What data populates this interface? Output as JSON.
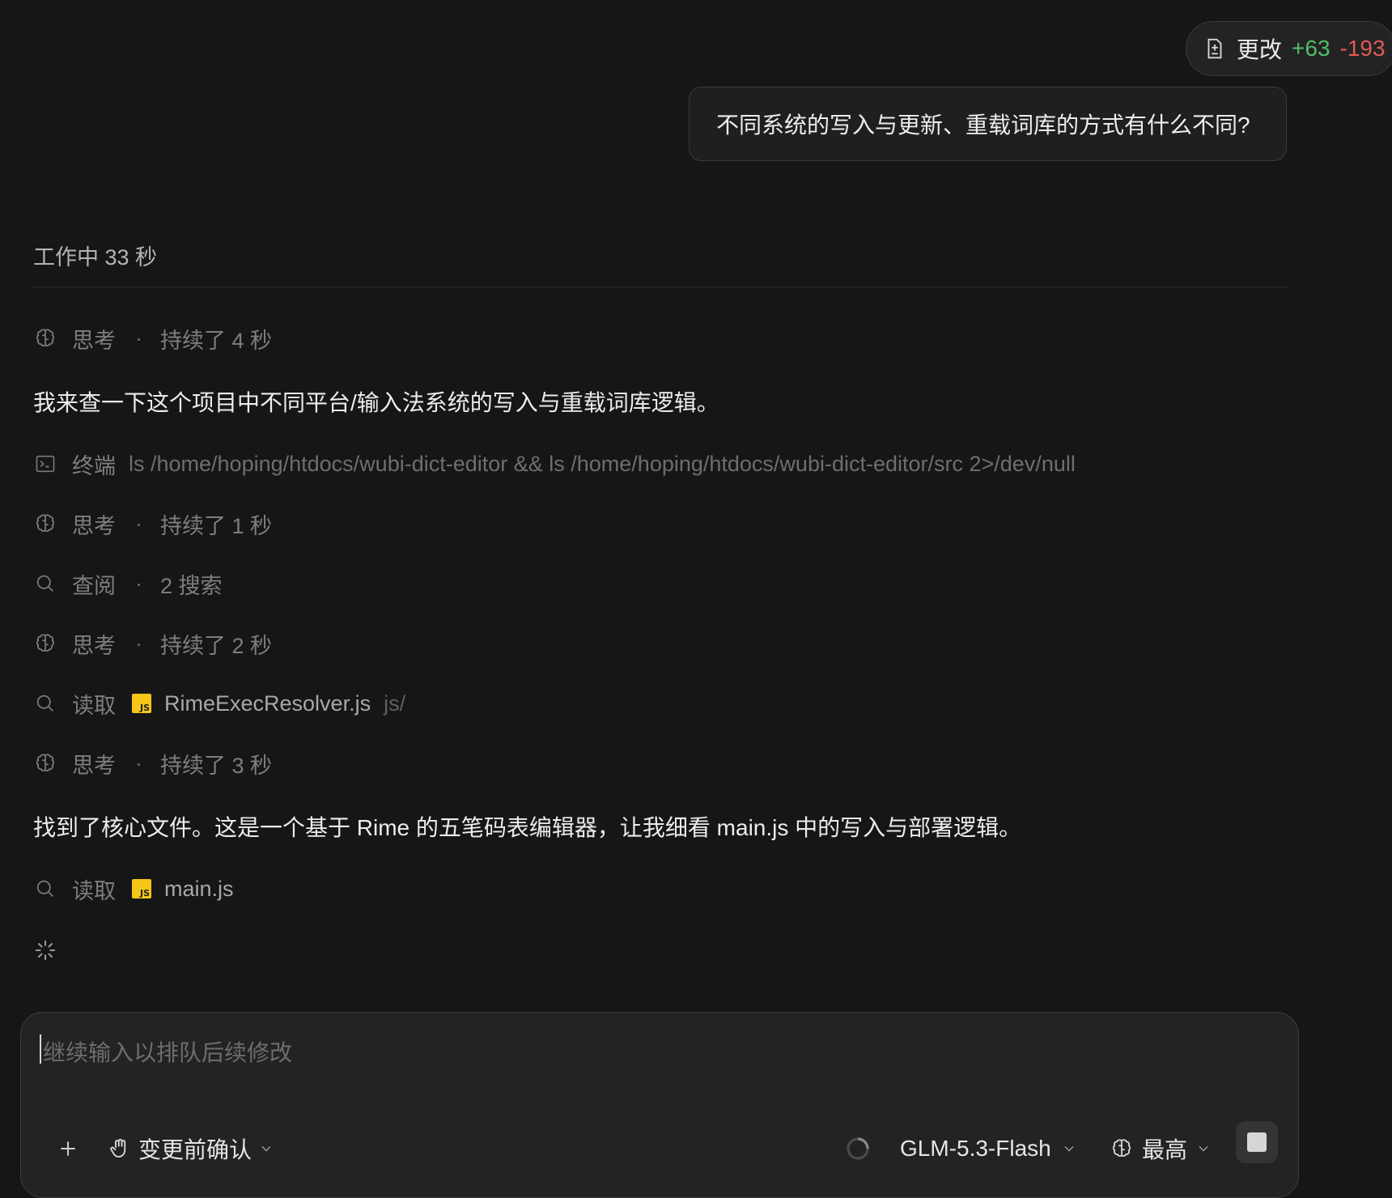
{
  "changes": {
    "label": "更改",
    "added": "+63",
    "removed": "-193",
    "icon": "file-diff-icon"
  },
  "user_message": "不同系统的写入与更新、重载词库的方式有什么不同?",
  "status": "工作中 33 秒",
  "steps": [
    {
      "type": "think",
      "label": "思考",
      "detail": "持续了 4 秒",
      "icon": "brain-icon"
    },
    {
      "type": "text",
      "text": "我来查一下这个项目中不同平台/输入法系统的写入与重载词库逻辑。"
    },
    {
      "type": "terminal",
      "label": "终端",
      "command": "ls /home/hoping/htdocs/wubi-dict-editor && ls /home/hoping/htdocs/wubi-dict-editor/src 2>/dev/null",
      "icon": "terminal-icon"
    },
    {
      "type": "think",
      "label": "思考",
      "detail": "持续了 1 秒",
      "icon": "brain-icon"
    },
    {
      "type": "search",
      "label": "查阅",
      "detail": "2 搜索",
      "icon": "search-icon"
    },
    {
      "type": "think",
      "label": "思考",
      "detail": "持续了 2 秒",
      "icon": "brain-icon"
    },
    {
      "type": "read",
      "label": "读取",
      "file": "RimeExecResolver.js",
      "path": "js/",
      "icon": "search-icon",
      "badge": "JS"
    },
    {
      "type": "think",
      "label": "思考",
      "detail": "持续了 3 秒",
      "icon": "brain-icon"
    },
    {
      "type": "text",
      "text": "找到了核心文件。这是一个基于 Rime 的五笔码表编辑器，让我细看 main.js 中的写入与部署逻辑。"
    },
    {
      "type": "read",
      "label": "读取",
      "file": "main.js",
      "path": "",
      "icon": "search-icon",
      "badge": "JS"
    }
  ],
  "composer": {
    "placeholder": "继续输入以排队后续修改",
    "mode_label": "变更前确认",
    "model_label": "GLM-5.3-Flash",
    "effort_label": "最高"
  },
  "colors": {
    "background": "#161616",
    "added": "#4fbf6a",
    "removed": "#e05858",
    "js_badge": "#f5c518"
  }
}
